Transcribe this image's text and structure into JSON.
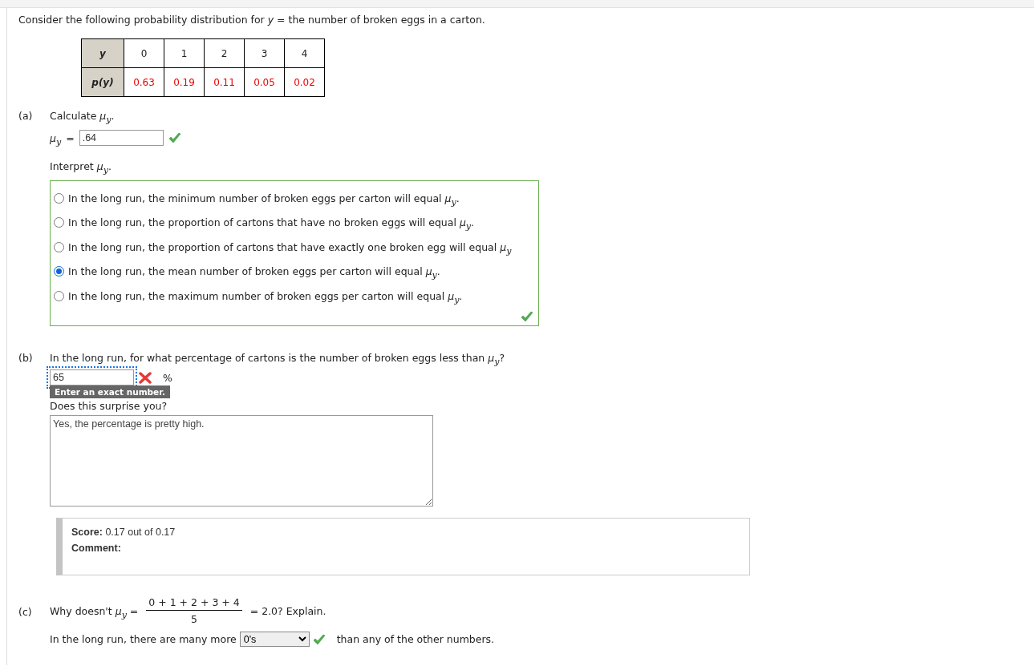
{
  "intro": "Consider the following probability distribution for *y* = the number of broken eggs in a carton.",
  "table": {
    "header": "y",
    "values": [
      "0",
      "1",
      "2",
      "3",
      "4"
    ],
    "row_label": "p(y)",
    "probabilities": [
      "0.63",
      "0.19",
      "0.11",
      "0.05",
      "0.02"
    ]
  },
  "part_a": {
    "label": "(a)",
    "prompt": "Calculate *μ*$_{y}$.",
    "answer_label": "*μ*$_{y}$",
    "equals": "=",
    "answer": ".64",
    "correct": true,
    "interpret_prompt": "Interpret *μ*$_{y}$.",
    "options": [
      {
        "text": "In the long run, the minimum number of broken eggs per carton will equal *μ*$_{y}$.",
        "selected": false
      },
      {
        "text": "In the long run, the proportion of cartons that have no broken eggs will equal *μ*$_{y}$.",
        "selected": false
      },
      {
        "text": "In the long run, the proportion of cartons that have exactly one broken egg will equal *μ*$_{y}$",
        "selected": false
      },
      {
        "text": "In the long run, the mean number of broken eggs per carton will equal *μ*$_{y}$.",
        "selected": true
      },
      {
        "text": "In the long run, the maximum number of broken eggs per carton will equal *μ*$_{y}$.",
        "selected": false
      }
    ],
    "options_correct": true
  },
  "part_b": {
    "label": "(b)",
    "question": "In the long run, for what percentage of cartons is the number of broken eggs less than *μ*$_{y}$?",
    "answer": "65",
    "correct": false,
    "tooltip": "Enter an exact number.",
    "unit": "%",
    "followup": "Does this surprise you?",
    "response": "Yes, the percentage is pretty high."
  },
  "score": {
    "label": "Score:",
    "value": "0.17 out of 0.17",
    "comment_label": "Comment:"
  },
  "part_c": {
    "label": "(c)",
    "lead": "Why doesn't *μ*$_{y}$ =",
    "numerator": "0 + 1 + 2 + 3 + 4",
    "denominator": "5",
    "tail": "= 2.0? Explain.",
    "sentence_start": "In the long run, there are many more",
    "choice": "0's",
    "correct": true,
    "sentence_end": "than any of the other numbers."
  }
}
